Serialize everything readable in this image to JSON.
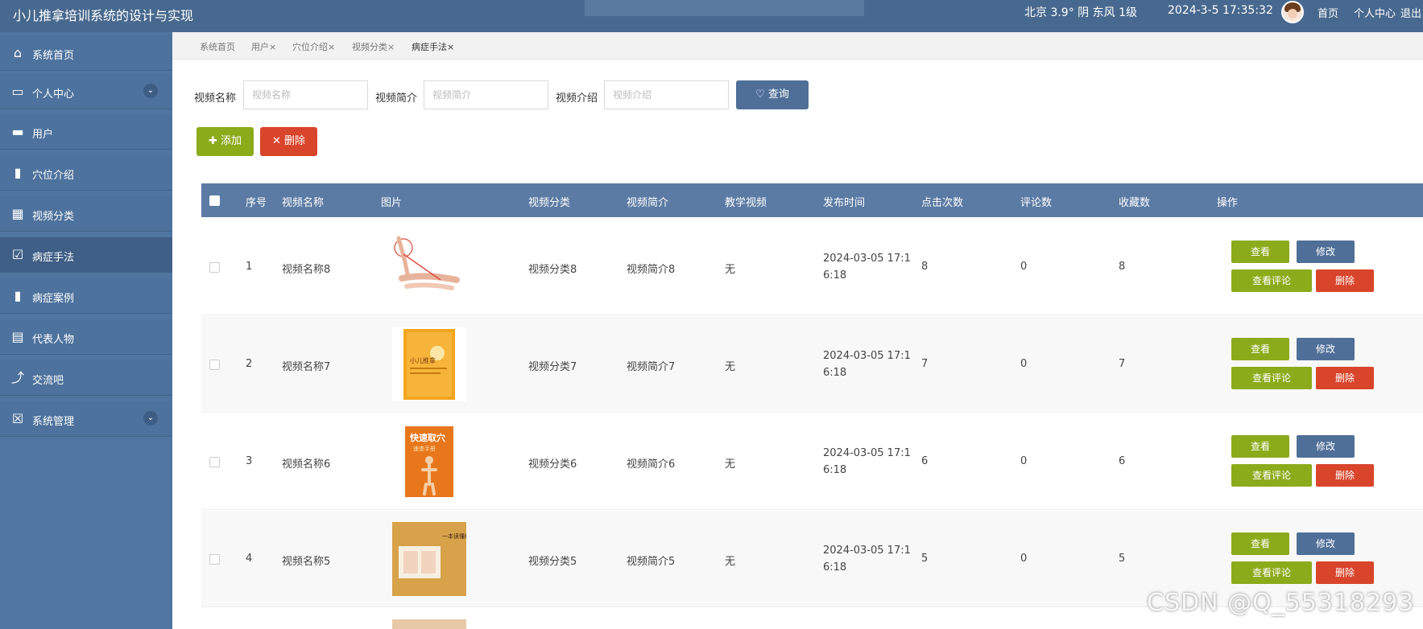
{
  "header": {
    "title": "小儿推拿培训系统的设计与实现",
    "weather": "北京  3.9°  阴  东风  1级",
    "datetime": "2024-3-5  17:35:32",
    "nav": [
      "首页",
      "个人中心",
      "退出"
    ]
  },
  "sidebar": {
    "items": [
      {
        "label": "系统首页",
        "icon": "home-icon",
        "glyph": "⌂"
      },
      {
        "label": "个人中心",
        "icon": "card-icon",
        "glyph": "▭"
      },
      {
        "label": "用户",
        "icon": "briefcase-icon",
        "glyph": "▬"
      },
      {
        "label": "穴位介绍",
        "icon": "ticket-icon",
        "glyph": "▮"
      },
      {
        "label": "视频分类",
        "icon": "grid-icon",
        "glyph": "▦"
      },
      {
        "label": "病症手法",
        "icon": "checkbox-icon",
        "glyph": "☑"
      },
      {
        "label": "病症案例",
        "icon": "bar-chart-icon",
        "glyph": "▮"
      },
      {
        "label": "代表人物",
        "icon": "clipboard-icon",
        "glyph": "▤"
      },
      {
        "label": "交流吧",
        "icon": "line-chart-icon",
        "glyph": "⤴"
      },
      {
        "label": "系统管理",
        "icon": "settings-box-icon",
        "glyph": "☒"
      }
    ],
    "expand_glyph": "⌄"
  },
  "tabs": [
    "系统首页",
    "用户×",
    "穴位介绍×",
    "视频分类×",
    "病症手法×"
  ],
  "search": {
    "fields": [
      {
        "label": "视频名称",
        "placeholder": "视频名称"
      },
      {
        "label": "视频简介",
        "placeholder": "视频简介"
      },
      {
        "label": "视频介绍",
        "placeholder": "视频介绍"
      }
    ],
    "query_label": "♡ 查询"
  },
  "toolbar": {
    "add_label": "✚ 添加",
    "delete_label": "✕ 删除"
  },
  "table": {
    "columns": [
      "序号",
      "视频名称",
      "图片",
      "视频分类",
      "视频简介",
      "教学视频",
      "发布时间",
      "点击次数",
      "评论数",
      "收藏数",
      "操作"
    ],
    "rows": [
      {
        "no": "1",
        "name": "视频名称8",
        "category": "视频分类8",
        "intro": "视频简介8",
        "video": "无",
        "time1": "2024-03-05 17:1",
        "time2": "6:18",
        "clicks": "8",
        "comments": "0",
        "favs": "8"
      },
      {
        "no": "2",
        "name": "视频名称7",
        "category": "视频分类7",
        "intro": "视频简介7",
        "video": "无",
        "time1": "2024-03-05 17:1",
        "time2": "6:18",
        "clicks": "7",
        "comments": "0",
        "favs": "7"
      },
      {
        "no": "3",
        "name": "视频名称6",
        "category": "视频分类6",
        "intro": "视频简介6",
        "video": "无",
        "time1": "2024-03-05 17:1",
        "time2": "6:18",
        "clicks": "6",
        "comments": "0",
        "favs": "6"
      },
      {
        "no": "4",
        "name": "视频名称5",
        "category": "视频分类5",
        "intro": "视频简介5",
        "video": "无",
        "time1": "2024-03-05 17:1",
        "time2": "6:18",
        "clicks": "5",
        "comments": "0",
        "favs": "5"
      }
    ],
    "actions": {
      "view": "查看",
      "edit": "修改",
      "comment": "查看评论",
      "delete": "删除"
    }
  },
  "book_titles": {
    "book2": "小儿推拿",
    "book3": "快速取穴",
    "book3_sub": "速查手册",
    "book4": "一本读懂经络穴位"
  },
  "watermark": "CSDN @Q_55318293",
  "colors": {
    "header": "#48698f",
    "sidebar": "#4d729d",
    "primary": "#4f6f98",
    "success": "#8cab1b",
    "danger": "#d9452b"
  }
}
